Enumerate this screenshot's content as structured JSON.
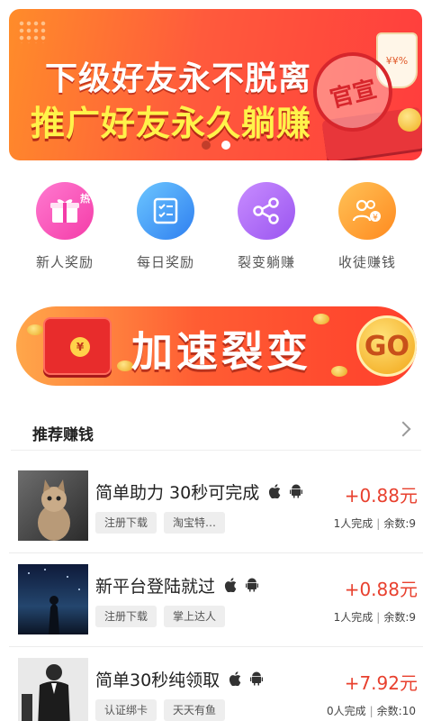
{
  "banner": {
    "line1": "下级好友永不脱离",
    "line2": "推广好友永久躺赚",
    "seal": "官宣",
    "cup_text": "¥¥%",
    "pager_count": 2,
    "pager_active": 1
  },
  "menu": [
    {
      "label": "新人奖励",
      "icon": "gift-icon",
      "badge": "热",
      "color": "#f43ca8"
    },
    {
      "label": "每日奖励",
      "icon": "checklist-icon",
      "color": "#2f7ff0"
    },
    {
      "label": "裂变躺赚",
      "icon": "share-icon",
      "color": "#9a55f0"
    },
    {
      "label": "收徒赚钱",
      "icon": "users-coin-icon",
      "badge": "¥",
      "color": "#ff8a1f"
    }
  ],
  "promo": {
    "text": "加速裂变",
    "go_label": "GO",
    "envelope_mark": "¥"
  },
  "section": {
    "title": "推荐赚钱"
  },
  "tasks": [
    {
      "name": "简单助力 30秒可完成",
      "tags": [
        "注册下载",
        "淘宝特…"
      ],
      "reward": "+0.88元",
      "done": "1人完成",
      "remain": "余数:9"
    },
    {
      "name": "新平台登陆就过",
      "tags": [
        "注册下载",
        "掌上达人"
      ],
      "reward": "+0.88元",
      "done": "1人完成",
      "remain": "余数:9"
    },
    {
      "name": "简单30秒纯领取",
      "tags": [
        "认证绑卡",
        "天天有鱼"
      ],
      "reward": "+7.92元",
      "done": "0人完成",
      "remain": "余数:10"
    }
  ],
  "meta_separator": "|",
  "colors": {
    "accent_red": "#e8402e",
    "banner_orange": "#ff5a3c"
  }
}
